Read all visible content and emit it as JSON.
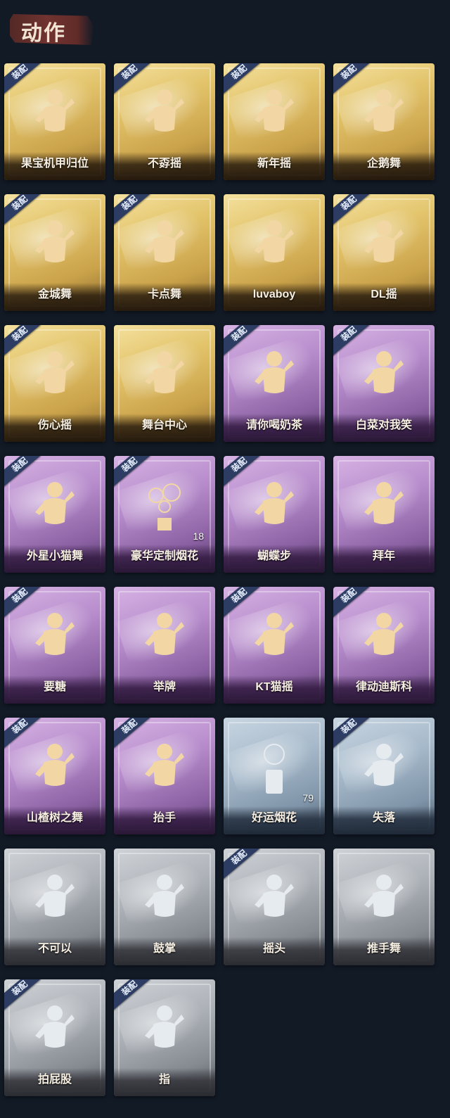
{
  "header": {
    "title": "动作"
  },
  "equip_badge_text": "装配",
  "colors": {
    "gold": "#e2c36a",
    "purple": "#b68bcb",
    "blue": "#a6b9ca",
    "gray": "#adb2b8",
    "badge": "#2c3c63"
  },
  "cards": [
    {
      "label": "果宝机甲归位",
      "tier": "gold",
      "equipped": true,
      "icon": "dance-pose-icon"
    },
    {
      "label": "不孬摇",
      "tier": "gold",
      "equipped": true,
      "icon": "dance-pose-icon"
    },
    {
      "label": "新年摇",
      "tier": "gold",
      "equipped": true,
      "icon": "dance-pose-icon"
    },
    {
      "label": "企鹅舞",
      "tier": "gold",
      "equipped": true,
      "icon": "dance-pose-icon"
    },
    {
      "label": "金城舞",
      "tier": "gold",
      "equipped": true,
      "icon": "dance-pose-icon"
    },
    {
      "label": "卡点舞",
      "tier": "gold",
      "equipped": true,
      "icon": "dance-pose-icon"
    },
    {
      "label": "luvaboy",
      "tier": "gold",
      "equipped": false,
      "icon": "dance-pose-icon"
    },
    {
      "label": "DL摇",
      "tier": "gold",
      "equipped": true,
      "icon": "dance-pose-icon"
    },
    {
      "label": "伤心摇",
      "tier": "gold",
      "equipped": true,
      "icon": "heart-pose-icon"
    },
    {
      "label": "舞台中心",
      "tier": "gold",
      "equipped": false,
      "icon": "dance-pose-icon"
    },
    {
      "label": "请你喝奶茶",
      "tier": "purple",
      "equipped": true,
      "icon": "sign-pose-icon"
    },
    {
      "label": "白菜对我笑",
      "tier": "purple",
      "equipped": true,
      "icon": "dance-pose-icon"
    },
    {
      "label": "外星小猫舞",
      "tier": "purple",
      "equipped": true,
      "icon": "dance-pose-icon"
    },
    {
      "label": "豪华定制烟花",
      "tier": "purple",
      "equipped": true,
      "icon": "fireworks-icon",
      "count": "18"
    },
    {
      "label": "蝴蝶步",
      "tier": "purple",
      "equipped": true,
      "icon": "dance-pose-icon"
    },
    {
      "label": "拜年",
      "tier": "purple",
      "equipped": false,
      "icon": "bow-pose-icon"
    },
    {
      "label": "要糖",
      "tier": "purple",
      "equipped": true,
      "icon": "ask-pose-icon"
    },
    {
      "label": "举牌",
      "tier": "purple",
      "equipped": false,
      "icon": "sign-pose-icon"
    },
    {
      "label": "KT猫摇",
      "tier": "purple",
      "equipped": true,
      "icon": "dance-pose-icon"
    },
    {
      "label": "律动迪斯科",
      "tier": "purple",
      "equipped": true,
      "icon": "dance-pose-icon"
    },
    {
      "label": "山楂树之舞",
      "tier": "purple",
      "equipped": true,
      "icon": "dance-pose-icon"
    },
    {
      "label": "抬手",
      "tier": "purple",
      "equipped": true,
      "icon": "raise-hand-icon"
    },
    {
      "label": "好运烟花",
      "tier": "blue",
      "equipped": false,
      "icon": "firework-can-icon",
      "count": "79"
    },
    {
      "label": "失落",
      "tier": "blue",
      "equipped": true,
      "icon": "crawl-pose-icon"
    },
    {
      "label": "不可以",
      "tier": "gray",
      "equipped": false,
      "icon": "finger-wag-icon"
    },
    {
      "label": "鼓掌",
      "tier": "gray",
      "equipped": false,
      "icon": "clap-icon"
    },
    {
      "label": "摇头",
      "tier": "gray",
      "equipped": true,
      "icon": "shake-head-icon"
    },
    {
      "label": "推手舞",
      "tier": "gray",
      "equipped": false,
      "icon": "push-hands-icon"
    },
    {
      "label": "拍屁股",
      "tier": "gray",
      "equipped": true,
      "icon": "pat-pose-icon"
    },
    {
      "label": "指",
      "tier": "gray",
      "equipped": true,
      "icon": "point-icon"
    }
  ]
}
